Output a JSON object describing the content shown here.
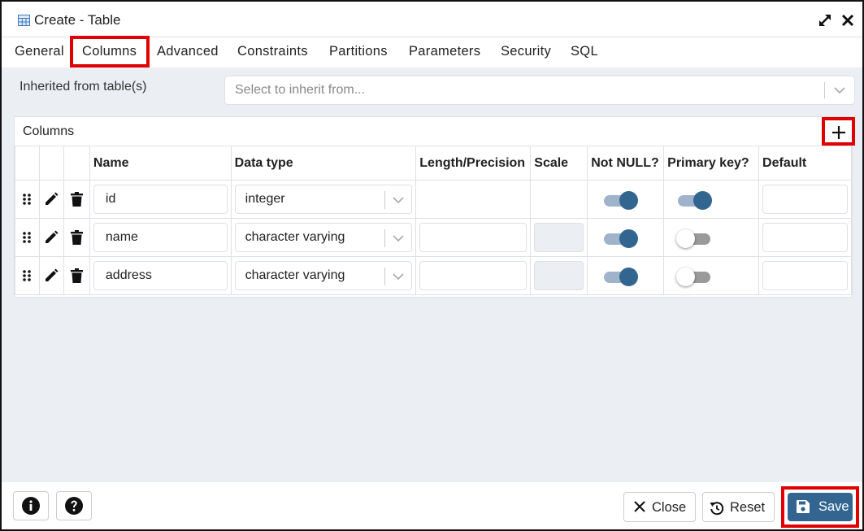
{
  "window": {
    "title": "Create - Table",
    "icon": "table-icon"
  },
  "tabs": [
    {
      "label": "General"
    },
    {
      "label": "Columns",
      "active": true
    },
    {
      "label": "Advanced"
    },
    {
      "label": "Constraints"
    },
    {
      "label": "Partitions"
    },
    {
      "label": "Parameters"
    },
    {
      "label": "Security"
    },
    {
      "label": "SQL"
    }
  ],
  "inherit": {
    "label": "Inherited from table(s)",
    "placeholder": "Select to inherit from..."
  },
  "columns_panel": {
    "title": "Columns",
    "headers": [
      "Name",
      "Data type",
      "Length/Precision",
      "Scale",
      "Not NULL?",
      "Primary key?",
      "Default"
    ],
    "rows": [
      {
        "name": "id",
        "data_type": "integer",
        "not_null": true,
        "primary_key": true
      },
      {
        "name": "name",
        "data_type": "character varying",
        "not_null": true,
        "primary_key": false
      },
      {
        "name": "address",
        "data_type": "character varying",
        "not_null": true,
        "primary_key": false
      }
    ]
  },
  "footer": {
    "close_label": "Close",
    "reset_label": "Reset",
    "save_label": "Save"
  },
  "colors": {
    "accent": "#326690",
    "highlight": "#e00000",
    "panel_bg": "#ebeef3"
  }
}
